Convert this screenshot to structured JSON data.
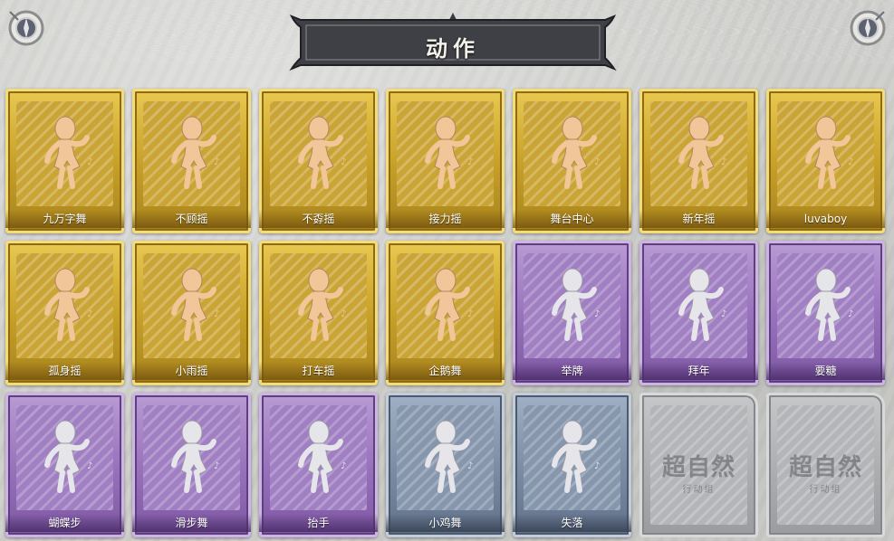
{
  "title": "动作",
  "cards": [
    {
      "label": "九万字舞",
      "tier": "gold",
      "icon": "dance-figure-icon"
    },
    {
      "label": "不顾摇",
      "tier": "gold",
      "icon": "dance-figure-icon"
    },
    {
      "label": "不孬摇",
      "tier": "gold",
      "icon": "dance-figure-icon"
    },
    {
      "label": "接力摇",
      "tier": "gold",
      "icon": "dance-figure-icon"
    },
    {
      "label": "舞台中心",
      "tier": "gold",
      "icon": "dance-figure-icon"
    },
    {
      "label": "新年摇",
      "tier": "gold",
      "icon": "dance-figure-icon"
    },
    {
      "label": "luvaboy",
      "tier": "gold",
      "icon": "dance-figure-icon"
    },
    {
      "label": "孤身摇",
      "tier": "gold",
      "icon": "dance-figure-icon"
    },
    {
      "label": "小雨摇",
      "tier": "gold",
      "icon": "dance-figure-icon"
    },
    {
      "label": "打车摇",
      "tier": "gold",
      "icon": "dance-figure-icon"
    },
    {
      "label": "企鹅舞",
      "tier": "gold",
      "icon": "dance-figure-icon"
    },
    {
      "label": "举牌",
      "tier": "purple",
      "icon": "sign-holding-figure-icon"
    },
    {
      "label": "拜年",
      "tier": "purple",
      "icon": "bowing-figure-icon"
    },
    {
      "label": "要糖",
      "tier": "purple",
      "icon": "reaching-figure-icon"
    },
    {
      "label": "蝴蝶步",
      "tier": "purple",
      "icon": "pointing-figure-icon"
    },
    {
      "label": "滑步舞",
      "tier": "purple",
      "icon": "dance-figure-icon"
    },
    {
      "label": "抬手",
      "tier": "purple",
      "icon": "raise-hand-figure-icon"
    },
    {
      "label": "小鸡舞",
      "tier": "slate",
      "icon": "chicken-dance-figure-icon"
    },
    {
      "label": "失落",
      "tier": "slate",
      "icon": "crawling-figure-icon"
    },
    {
      "label": "",
      "tier": "locked",
      "icon": "locked-card-icon"
    },
    {
      "label": "",
      "tier": "locked",
      "icon": "locked-card-icon"
    }
  ],
  "watermark": {
    "main": "超自然",
    "sub": "行动组"
  },
  "colors": {
    "gold": "#c9a22a",
    "purple": "#9a73bd",
    "slate": "#7d8ea6",
    "locked": "#a9abad",
    "figure_gold": "#f1c79a",
    "figure_silver": "#e6e6ea"
  }
}
